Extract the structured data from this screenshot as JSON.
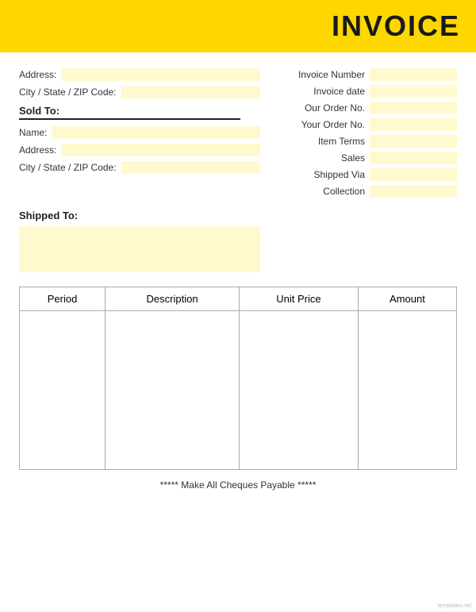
{
  "header": {
    "title": "INVOICE",
    "bg_color": "#FFD700"
  },
  "left_top": {
    "address_label": "Address:",
    "city_label": "City / State / ZIP Code:"
  },
  "sold_to": {
    "label": "Sold To:",
    "name_label": "Name:",
    "address_label": "Address:",
    "city_label": "City / State / ZIP Code:"
  },
  "shipped_to": {
    "label": "Shipped To:"
  },
  "right_fields": [
    {
      "label": "Invoice Number"
    },
    {
      "label": "Invoice date"
    },
    {
      "label": "Our Order No."
    },
    {
      "label": "Your Order No."
    },
    {
      "label": "Item Terms"
    },
    {
      "label": "Sales"
    },
    {
      "label": "Shipped Via"
    },
    {
      "label": "Collection"
    }
  ],
  "table": {
    "columns": [
      "Period",
      "Description",
      "Unit Price",
      "Amount"
    ]
  },
  "footer": {
    "text": "***** Make All Cheques Payable *****"
  },
  "watermark": "templates.net"
}
